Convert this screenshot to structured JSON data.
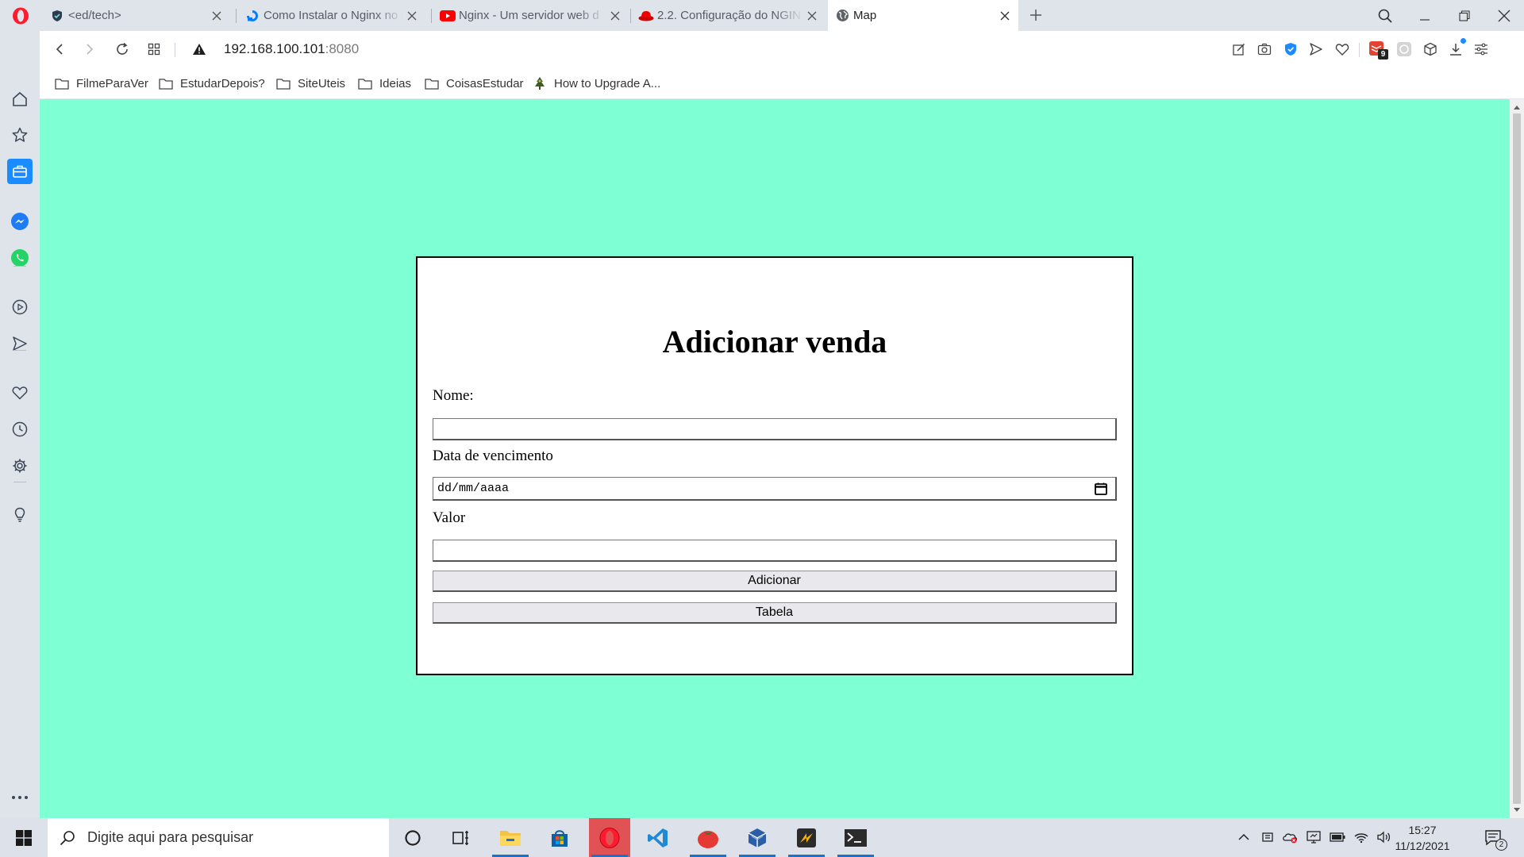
{
  "browser": {
    "tabs": [
      {
        "label": "<ed/tech>",
        "icon": "edtech-shield-icon",
        "active": false
      },
      {
        "label": "Como Instalar o Nginx no U",
        "icon": "digitalocean-icon",
        "active": false
      },
      {
        "label": "Nginx - Um servidor web d",
        "icon": "youtube-icon",
        "active": false
      },
      {
        "label": "2.2. Configuração do NGIN",
        "icon": "redhat-icon",
        "active": false
      },
      {
        "label": "Map",
        "icon": "globe-icon",
        "active": true
      }
    ],
    "address": {
      "host": "192.168.100.101",
      "port": ":8080"
    },
    "bookmarks": [
      {
        "label": "FilmeParaVer",
        "icon": "folder-icon"
      },
      {
        "label": "EstudarDepois?",
        "icon": "folder-icon"
      },
      {
        "label": "SiteUteis",
        "icon": "folder-icon"
      },
      {
        "label": "Ideias",
        "icon": "folder-icon"
      },
      {
        "label": "CoisasEstudar",
        "icon": "folder-icon"
      },
      {
        "label": "How to Upgrade A...",
        "icon": "site-favicon-icon"
      }
    ],
    "extension_badge": "9"
  },
  "page": {
    "background": "#7fffd4",
    "title": "Adicionar venda",
    "fields": {
      "nome_label": "Nome:",
      "nome_value": "",
      "data_label": "Data de vencimento",
      "data_placeholder": "dd/mm/aaaa",
      "valor_label": "Valor",
      "valor_value": ""
    },
    "buttons": {
      "adicionar": "Adicionar",
      "tabela": "Tabela"
    }
  },
  "taskbar": {
    "search_placeholder": "Digite aqui para pesquisar",
    "time": "15:27",
    "date": "11/12/2021",
    "notification_count": "2",
    "accent": "#1a73c9"
  }
}
